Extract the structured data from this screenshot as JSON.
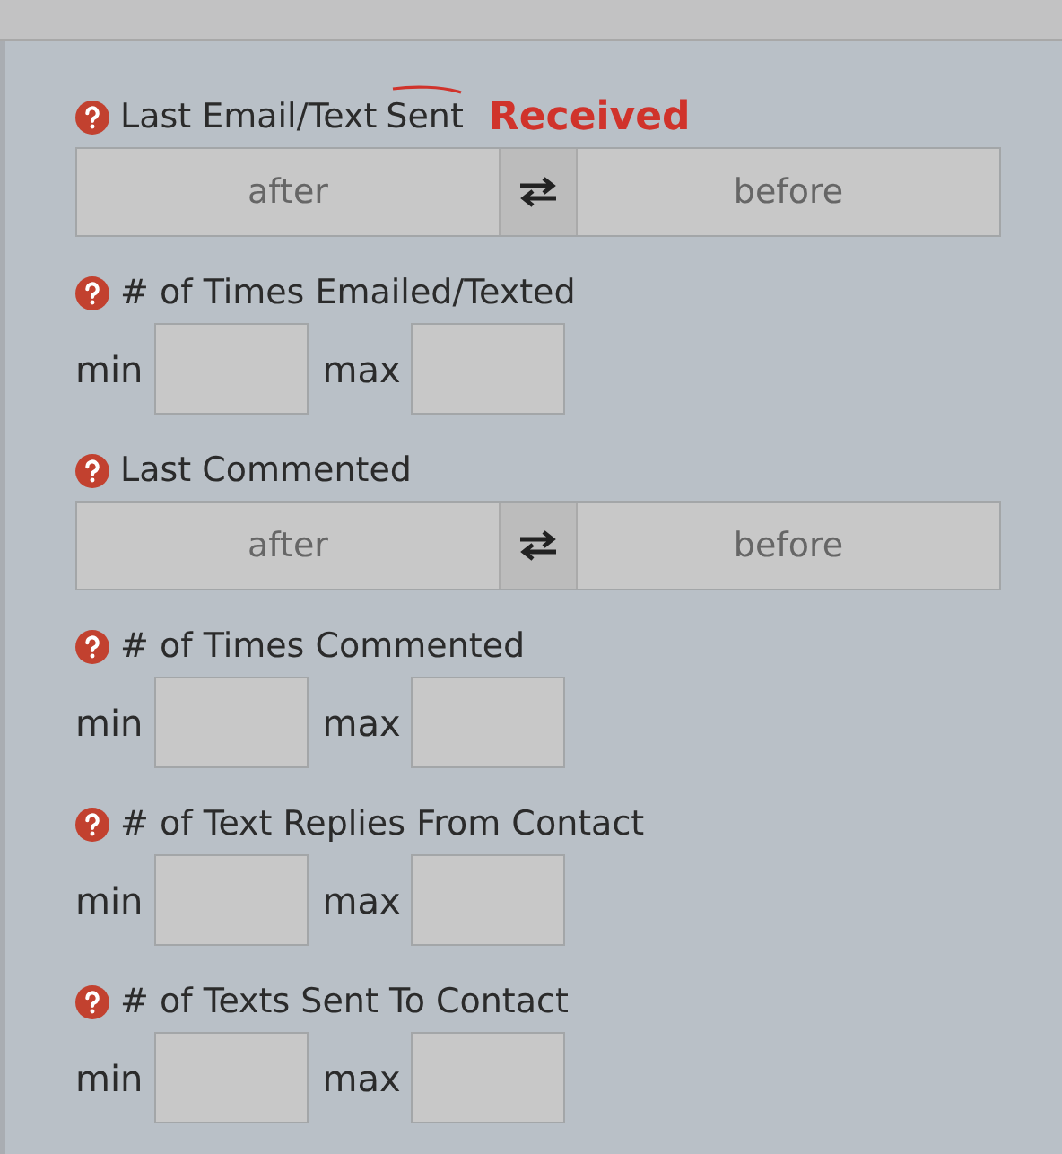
{
  "sections": [
    {
      "kind": "date_range",
      "label": "Last Email/Text",
      "struck": "Sent",
      "annotation": "Received",
      "from": "after",
      "to": "before"
    },
    {
      "kind": "min_max",
      "label": "# of Times Emailed/Texted",
      "min_label": "min",
      "max_label": "max"
    },
    {
      "kind": "date_range",
      "label": "Last Commented",
      "from": "after",
      "to": "before"
    },
    {
      "kind": "min_max",
      "label": "# of Times Commented",
      "min_label": "min",
      "max_label": "max"
    },
    {
      "kind": "min_max",
      "label": "# of Text Replies From Contact",
      "min_label": "min",
      "max_label": "max"
    },
    {
      "kind": "min_max",
      "label": "# of Texts Sent To Contact",
      "min_label": "min",
      "max_label": "max"
    }
  ]
}
